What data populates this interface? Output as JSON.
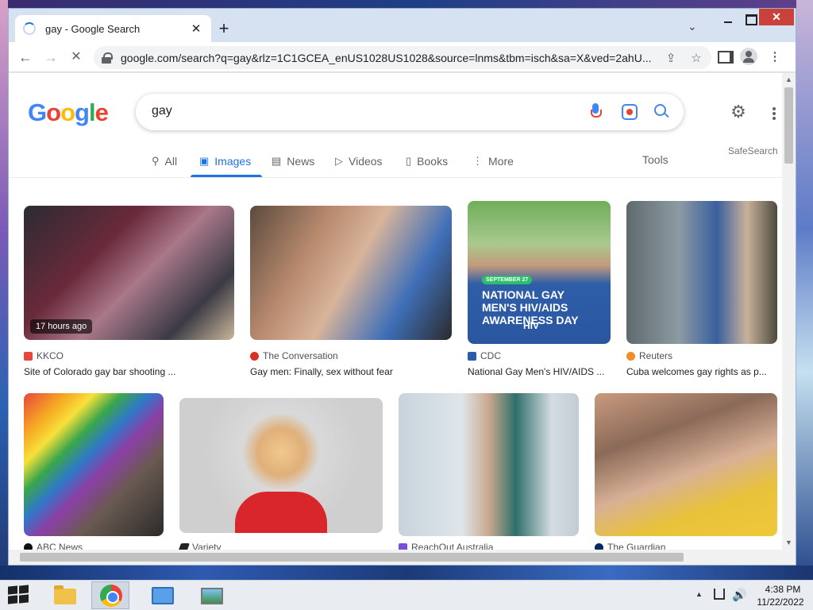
{
  "browser": {
    "tab_title": "gay - Google Search",
    "new_tab": "+",
    "url": "google.com/search?q=gay&rlz=1C1GCEA_enUS1028US1028&source=lnms&tbm=isch&sa=X&ved=2ahU..."
  },
  "search": {
    "query": "gay",
    "logo": [
      "G",
      "o",
      "o",
      "g",
      "l",
      "e"
    ]
  },
  "tabs": [
    {
      "label": "All",
      "icon": "search-icon"
    },
    {
      "label": "Images",
      "icon": "image-icon"
    },
    {
      "label": "News",
      "icon": "news-icon"
    },
    {
      "label": "Videos",
      "icon": "play-icon"
    },
    {
      "label": "Books",
      "icon": "book-icon"
    },
    {
      "label": "More",
      "icon": "more-vert-icon"
    }
  ],
  "tools_label": "Tools",
  "safesearch_label": "SafeSearch",
  "results": [
    {
      "source": "KKCO",
      "caption": "Site of Colorado gay bar shooting ...",
      "badge": "17 hours ago",
      "favicon_color": "#e8453c"
    },
    {
      "source": "The Conversation",
      "caption": "Gay men: Finally, sex without fear",
      "favicon_color": "#d93025"
    },
    {
      "source": "CDC",
      "caption": "National Gay Men's HIV/AIDS ...",
      "favicon_color": "#2a5caa",
      "poster": {
        "date": "SEPTEMBER 27",
        "title": "NATIONAL GAY MEN'S HIV/AIDS AWARENESS DAY",
        "logo": "HIV"
      }
    },
    {
      "source": "Reuters",
      "caption": "Cuba welcomes gay rights as p...",
      "favicon_color": "#f28c28"
    },
    {
      "source": "ABC News",
      "caption": "",
      "favicon_color": "#111111"
    },
    {
      "source": "Variety",
      "caption": "",
      "favicon_color": "#222222"
    },
    {
      "source": "ReachOut Australia",
      "caption": "",
      "favicon_color": "#7b4fd6"
    },
    {
      "source": "The Guardian",
      "caption": "",
      "favicon_color": "#052962"
    }
  ],
  "taskbar": {
    "time": "4:38 PM",
    "date": "11/22/2022"
  }
}
